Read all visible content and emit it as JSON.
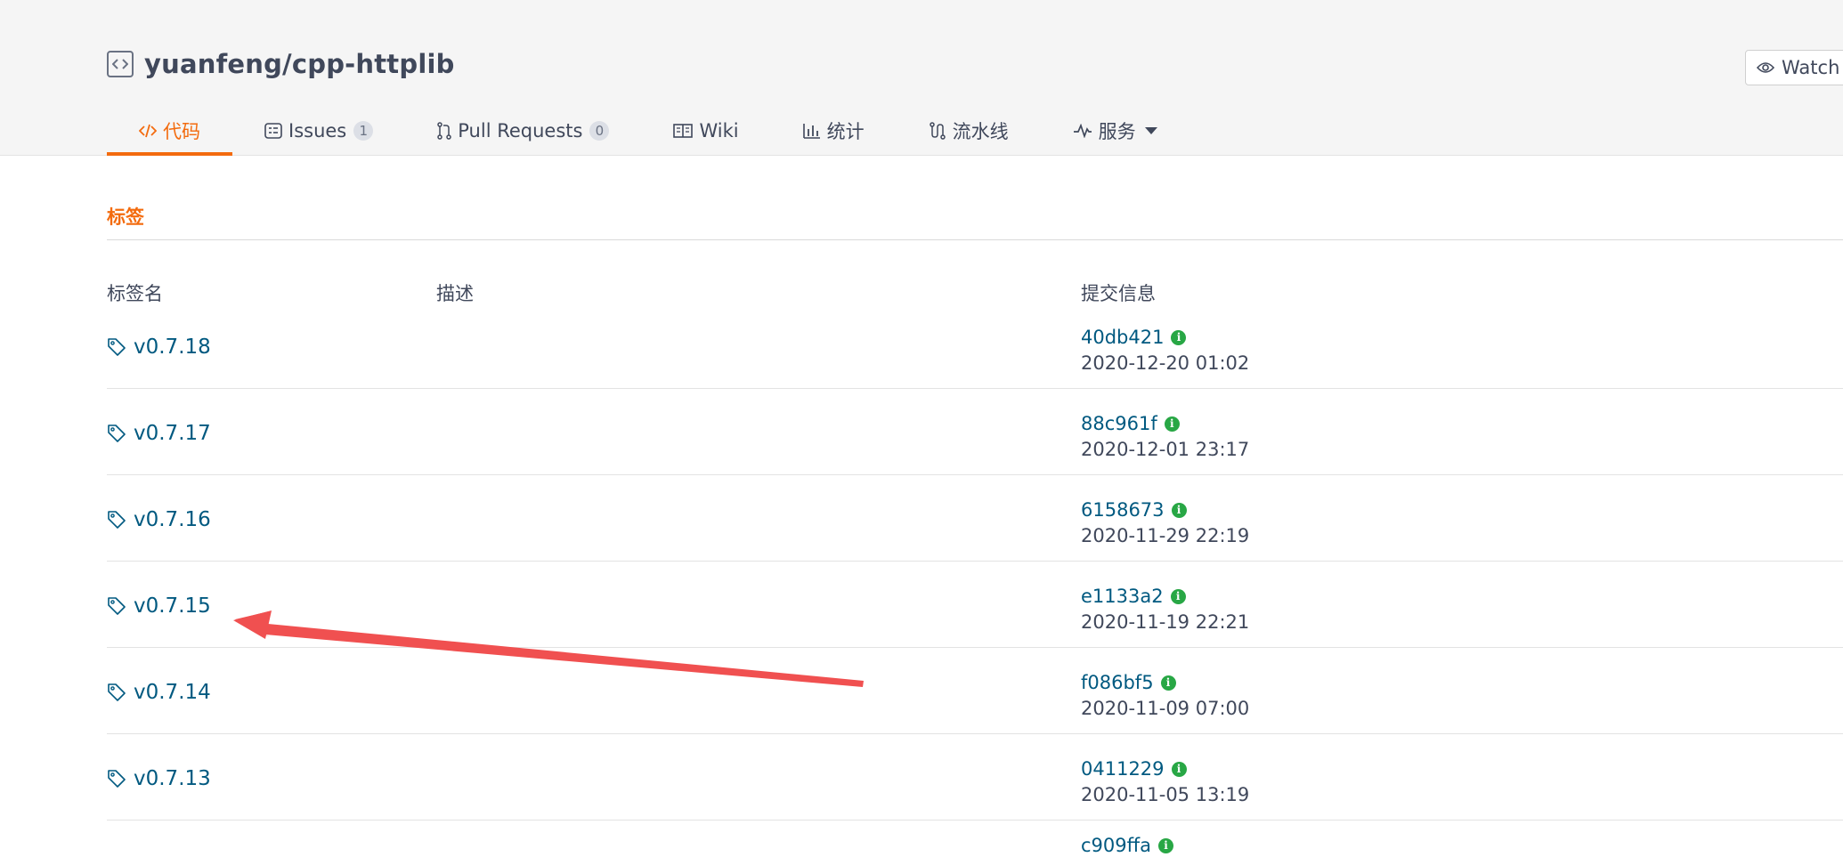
{
  "repo": {
    "full_name": "yuanfeng/cpp-httplib",
    "icon": "code-repo-icon"
  },
  "watch": {
    "label": "Watch",
    "icon": "eye-icon"
  },
  "tabs": [
    {
      "label": "代码",
      "icon": "code-icon",
      "active": true
    },
    {
      "label": "Issues",
      "icon": "issues-icon",
      "count": "1"
    },
    {
      "label": "Pull Requests",
      "icon": "pull-request-icon",
      "count": "0"
    },
    {
      "label": "Wiki",
      "icon": "book-icon"
    },
    {
      "label": "统计",
      "icon": "bar-chart-icon"
    },
    {
      "label": "流水线",
      "icon": "pipeline-icon"
    },
    {
      "label": "服务",
      "icon": "pulse-icon"
    }
  ],
  "section": {
    "title": "标签"
  },
  "table": {
    "headers": {
      "name": "标签名",
      "description": "描述",
      "commit": "提交信息"
    },
    "rows": [
      {
        "tag": "v0.7.18",
        "hash": "40db421",
        "date": "2020-12-20 01:02"
      },
      {
        "tag": "v0.7.17",
        "hash": "88c961f",
        "date": "2020-12-01 23:17"
      },
      {
        "tag": "v0.7.16",
        "hash": "6158673",
        "date": "2020-11-29 22:19"
      },
      {
        "tag": "v0.7.15",
        "hash": "e1133a2",
        "date": "2020-11-19 22:21"
      },
      {
        "tag": "v0.7.14",
        "hash": "f086bf5",
        "date": "2020-11-09 07:00"
      },
      {
        "tag": "v0.7.13",
        "hash": "0411229",
        "date": "2020-11-05 13:19"
      }
    ],
    "partial_row": {
      "hash": "c909ffa"
    }
  },
  "colors": {
    "accent": "#f36b0e",
    "link": "#005980",
    "info": "#28a745",
    "annotation_arrow": "#f05050"
  }
}
